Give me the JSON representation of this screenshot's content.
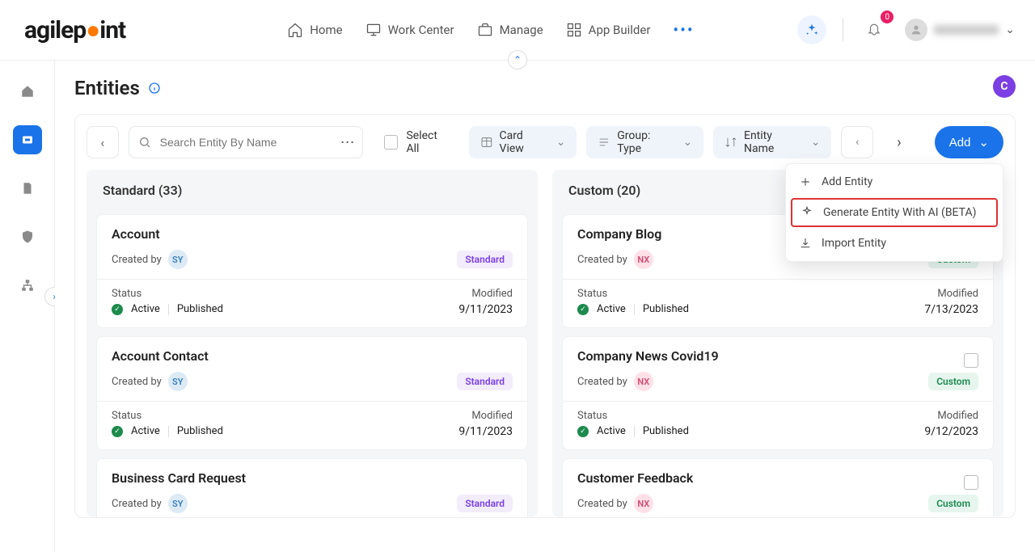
{
  "header": {
    "brand_a": "agilep",
    "brand_b": "int",
    "nav": {
      "home": "Home",
      "work_center": "Work Center",
      "manage": "Manage",
      "app_builder": "App Builder"
    },
    "notif_count": "0"
  },
  "page": {
    "title": "Entities"
  },
  "toolbar": {
    "search_placeholder": "Search Entity By Name",
    "select_all": "Select All",
    "card_view": "Card View",
    "group": "Group: Type",
    "sort": "Entity Name",
    "add": "Add"
  },
  "dropdown": {
    "add_entity": "Add Entity",
    "generate_ai": "Generate Entity With AI (BETA)",
    "import_entity": "Import Entity"
  },
  "columns": {
    "standard": {
      "title": "Standard (33)"
    },
    "custom": {
      "title": "Custom (20)"
    }
  },
  "labels": {
    "created_by": "Created by",
    "status": "Status",
    "modified": "Modified",
    "active": "Active",
    "published": "Published",
    "standard_badge": "Standard",
    "custom_badge": "Custom"
  },
  "std_cards": [
    {
      "title": "Account",
      "avatar": "SY",
      "modified": "9/11/2023"
    },
    {
      "title": "Account Contact",
      "avatar": "SY",
      "modified": "9/11/2023"
    },
    {
      "title": "Business Card Request",
      "avatar": "SY",
      "modified": ""
    }
  ],
  "cus_cards": [
    {
      "title": "Company Blog",
      "avatar": "NX",
      "modified": "7/13/2023",
      "show_check": false
    },
    {
      "title": "Company News Covid19",
      "avatar": "NX",
      "modified": "9/12/2023",
      "show_check": true
    },
    {
      "title": "Customer Feedback",
      "avatar": "NX",
      "modified": "",
      "show_check": true
    }
  ]
}
